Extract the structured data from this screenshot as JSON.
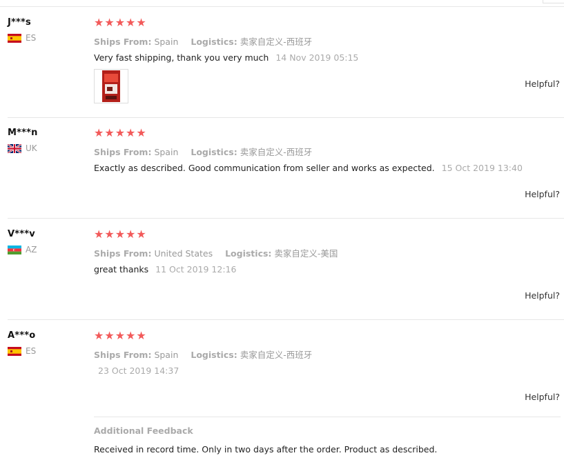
{
  "reviews": [
    {
      "user": "J***s",
      "country": "ES",
      "flag": "flag-spain-icon",
      "stars": "★★★★★",
      "ships_label": "Ships From:",
      "ships": "Spain",
      "logistics_label": "Logistics:",
      "logistics": "卖家自定义-西班牙",
      "text": "Very fast shipping, thank you very much",
      "date": "14 Nov 2019 05:15",
      "helpful": "Helpful?",
      "has_photo": true
    },
    {
      "user": "M***n",
      "country": "UK",
      "flag": "flag-uk-icon",
      "stars": "★★★★★",
      "ships_label": "Ships From:",
      "ships": "Spain",
      "logistics_label": "Logistics:",
      "logistics": "卖家自定义-西班牙",
      "text": "Exactly as described. Good communication from seller and works as expected.",
      "date": "15 Oct 2019 13:40",
      "helpful": "Helpful?"
    },
    {
      "user": "V***v",
      "country": "AZ",
      "flag": "flag-azerbaijan-icon",
      "stars": "★★★★★",
      "ships_label": "Ships From:",
      "ships": "United States",
      "logistics_label": "Logistics:",
      "logistics": "卖家自定义-美国",
      "text": "great thanks",
      "date": "11 Oct 2019 12:16",
      "helpful": "Helpful?"
    },
    {
      "user": "A***o",
      "country": "ES",
      "flag": "flag-spain-icon",
      "stars": "★★★★★",
      "ships_label": "Ships From:",
      "ships": "Spain",
      "logistics_label": "Logistics:",
      "logistics": "卖家自定义-西班牙",
      "text": "",
      "date": "23 Oct 2019 14:37",
      "helpful": "Helpful?"
    }
  ],
  "additional_feedback": {
    "title": "Additional Feedback",
    "text": "Received in record time. Only in two days after the order. Product as described."
  }
}
